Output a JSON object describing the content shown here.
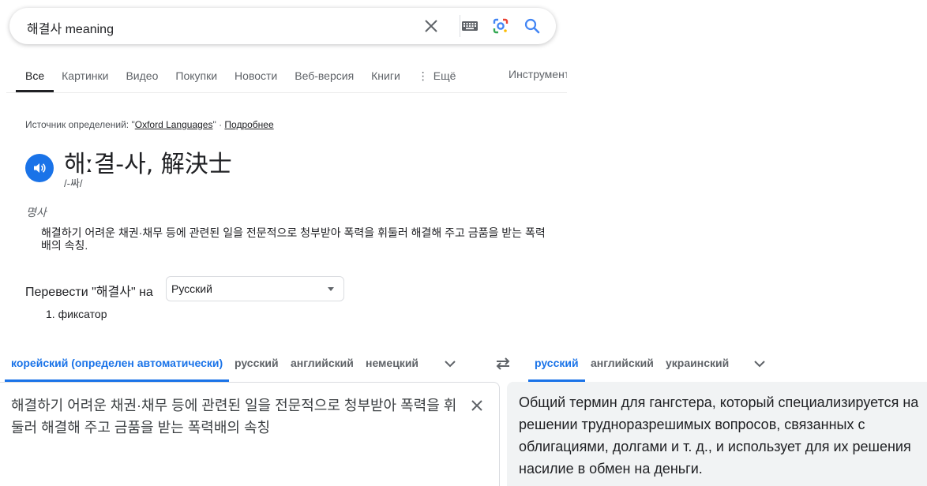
{
  "search": {
    "query": "해결사 meaning"
  },
  "tabs": [
    {
      "label": "Все",
      "active": true
    },
    {
      "label": "Картинки"
    },
    {
      "label": "Видео"
    },
    {
      "label": "Покупки"
    },
    {
      "label": "Новости"
    },
    {
      "label": "Веб-версия"
    },
    {
      "label": "Книги"
    },
    {
      "label": "Ещё"
    }
  ],
  "tools_label": "Инструменты",
  "dictionary": {
    "source_prefix": "Источник определений: \"",
    "source_name": "Oxford Languages",
    "source_suffix": "\" · ",
    "more_link": "Подробнее",
    "headword": "해ː결-사, 解決士",
    "phonetic": "/-싸/",
    "part_of_speech": "명사",
    "definition": "해결하기 어려운 채권·채무 등에 관련된 일을 전문적으로 청부받아 폭력을 휘둘러 해결해 주고 금품을 받는 폭력배의 속칭."
  },
  "translate_to": {
    "label": "Перевести \"해결사\" на",
    "selected_language": "Русский",
    "results": [
      "1. фиксатор"
    ]
  },
  "translator": {
    "source_langs": [
      "корейский (определен автоматически)",
      "русский",
      "английский",
      "немецкий"
    ],
    "target_langs": [
      "русский",
      "английский",
      "украинский"
    ],
    "source_text": "해결하기 어려운 채권·채무 등에 관련된 일을 전문적으로 청부받아 폭력을 휘둘러 해결해 주고 금품을 받는 폭력배의 속칭",
    "target_text": "Общий термин для гангстера, который специализируется на решении трудноразрешимых вопросов, связанных с облигациями, долгами и т. д., и использует для их решения насилие в обмен на деньги."
  },
  "colors": {
    "accent": "#1a73e8",
    "target_bg": "#f1f3f4"
  }
}
